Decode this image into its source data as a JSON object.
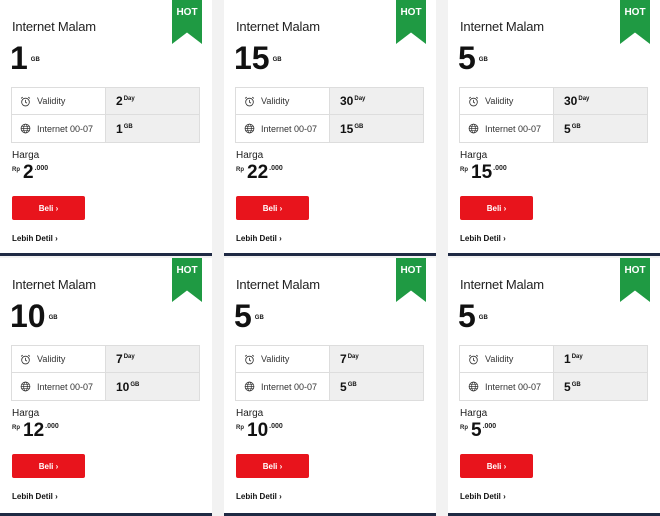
{
  "hot_label": "HOT",
  "labels": {
    "validity": "Validity",
    "internet": "Internet 00-07",
    "harga": "Harga",
    "rp": "Rp",
    "beli": "Beli ›",
    "lebih_detil": "Lebih Detil ›"
  },
  "colors": {
    "accent_red": "#e8141c",
    "hot_green": "#1f9a43",
    "divider_navy": "#1f2a44"
  },
  "cards": [
    {
      "title": "Internet Malam",
      "quota": "1",
      "quota_unit": "GB",
      "validity": "2",
      "validity_unit": "Day",
      "internet": "1",
      "internet_unit": "GB",
      "price": "2",
      "price_dec": ".000"
    },
    {
      "title": "Internet Malam",
      "quota": "15",
      "quota_unit": "GB",
      "validity": "30",
      "validity_unit": "Day",
      "internet": "15",
      "internet_unit": "GB",
      "price": "22",
      "price_dec": ".000"
    },
    {
      "title": "Internet Malam",
      "quota": "5",
      "quota_unit": "GB",
      "validity": "30",
      "validity_unit": "Day",
      "internet": "5",
      "internet_unit": "GB",
      "price": "15",
      "price_dec": ".000"
    },
    {
      "title": "Internet Malam",
      "quota": "10",
      "quota_unit": "GB",
      "validity": "7",
      "validity_unit": "Day",
      "internet": "10",
      "internet_unit": "GB",
      "price": "12",
      "price_dec": ".000"
    },
    {
      "title": "Internet Malam",
      "quota": "5",
      "quota_unit": "GB",
      "validity": "7",
      "validity_unit": "Day",
      "internet": "5",
      "internet_unit": "GB",
      "price": "10",
      "price_dec": ".000"
    },
    {
      "title": "Internet Malam",
      "quota": "5",
      "quota_unit": "GB",
      "validity": "1",
      "validity_unit": "Day",
      "internet": "5",
      "internet_unit": "GB",
      "price": "5",
      "price_dec": ".000"
    }
  ]
}
